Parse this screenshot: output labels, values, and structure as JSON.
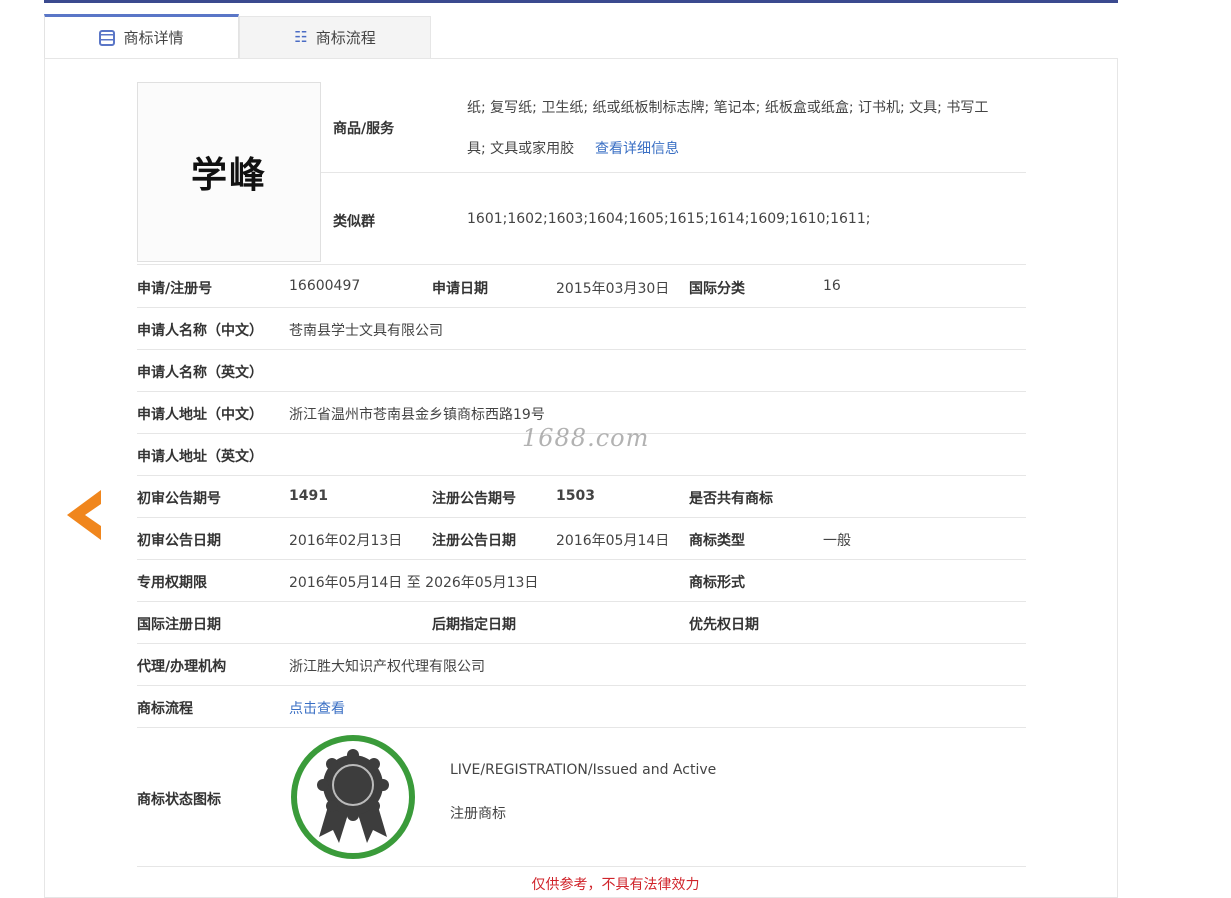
{
  "tabs": [
    {
      "label": "商标详情",
      "icon": "document-icon"
    },
    {
      "label": "商标流程",
      "icon": "list-icon"
    }
  ],
  "trademark": {
    "logo_text": "学峰",
    "goods_label": "商品/服务",
    "goods_line1": "纸; 复写纸; 卫生纸; 纸或纸板制标志牌; 笔记本; 纸板盒或纸盒; 订书机; 文具; 书写工",
    "goods_line2": "具; 文具或家用胶",
    "goods_more_link": "查看详细信息",
    "similar_label": "类似群",
    "similar_value": "1601;1602;1603;1604;1605;1615;1614;1609;1610;1611;"
  },
  "fields": {
    "reg_no_label": "申请/注册号",
    "reg_no": "16600497",
    "apply_date_label": "申请日期",
    "apply_date": "2015年03月30日",
    "intl_class_label": "国际分类",
    "intl_class": "16",
    "applicant_cn_label": "申请人名称（中文）",
    "applicant_cn": "苍南县学士文具有限公司",
    "applicant_en_label": "申请人名称（英文）",
    "address_cn_label": "申请人地址（中文）",
    "address_cn": "浙江省温州市苍南县金乡镇商标西路19号",
    "address_en_label": "申请人地址（英文）",
    "prelim_no_label": "初审公告期号",
    "prelim_no": "1491",
    "reg_notice_no_label": "注册公告期号",
    "reg_notice_no": "1503",
    "shared_label": "是否共有商标",
    "prelim_date_label": "初审公告日期",
    "prelim_date": "2016年02月13日",
    "reg_notice_date_label": "注册公告日期",
    "reg_notice_date": "2016年05月14日",
    "tm_type_label": "商标类型",
    "tm_type": "一般",
    "exclusive_label": "专用权期限",
    "exclusive_period": "2016年05月14日 至 2026年05月13日",
    "tm_form_label": "商标形式",
    "intl_reg_date_label": "国际注册日期",
    "later_date_label": "后期指定日期",
    "priority_date_label": "优先权日期",
    "agency_label": "代理/办理机构",
    "agency": "浙江胜大知识产权代理有限公司",
    "process_label": "商标流程",
    "process_link": "点击查看",
    "status_icon_label": "商标状态图标",
    "status_en": "LIVE/REGISTRATION/Issued and Active",
    "status_cn": "注册商标"
  },
  "watermark": "1688.com",
  "footer_note": "仅供参考，不具有法律效力",
  "colors": {
    "accent": "#3b4a8f",
    "link": "#3a6fc4",
    "arrow": "#f0861d",
    "badge_ring": "#3a9b3a",
    "note": "#d0242b"
  }
}
